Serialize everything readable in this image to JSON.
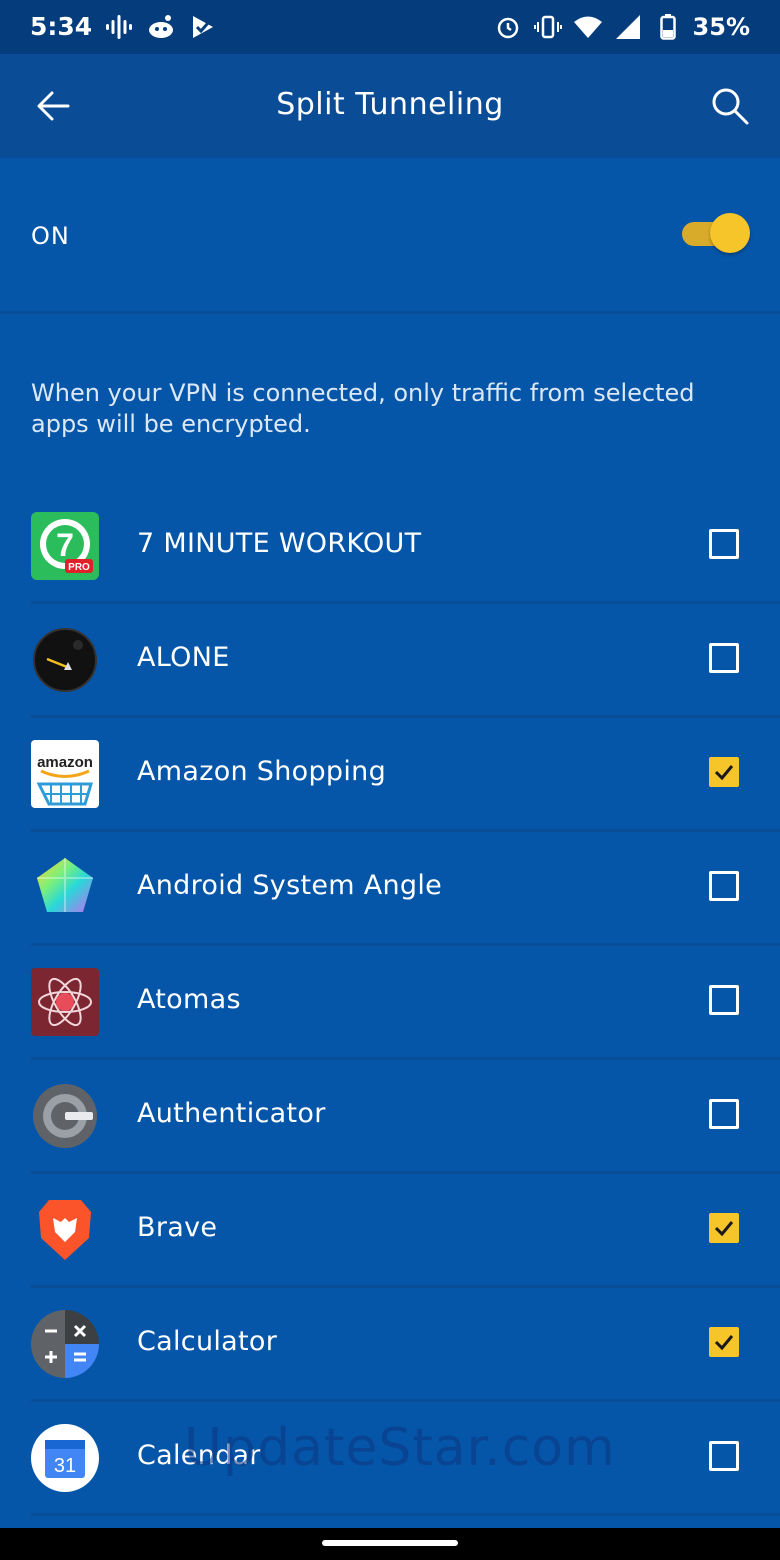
{
  "status_bar": {
    "time": "5:34",
    "battery": "35%",
    "left_icons": [
      "podcast-icon",
      "reddit-icon",
      "check-play-icon"
    ],
    "right_icons": [
      "alarm-icon",
      "vibrate-icon",
      "wifi-icon",
      "signal-icon",
      "battery-icon"
    ]
  },
  "app_bar": {
    "title": "Split Tunneling",
    "back_icon": "arrow-left-icon",
    "search_icon": "search-icon"
  },
  "toggle": {
    "label": "ON",
    "state": "on",
    "accent_color": "#f6c52a"
  },
  "description": "When your VPN is connected, only traffic from selected apps will be encrypted.",
  "apps": [
    {
      "name": "7 MINUTE WORKOUT",
      "icon": "seven-minute-workout-icon",
      "checked": false
    },
    {
      "name": "ALONE",
      "icon": "alone-icon",
      "checked": false
    },
    {
      "name": "Amazon Shopping",
      "icon": "amazon-icon",
      "checked": true
    },
    {
      "name": "Android System Angle",
      "icon": "angle-gem-icon",
      "checked": false
    },
    {
      "name": "Atomas",
      "icon": "atomas-icon",
      "checked": false
    },
    {
      "name": "Authenticator",
      "icon": "authenticator-icon",
      "checked": false
    },
    {
      "name": "Brave",
      "icon": "brave-lion-icon",
      "checked": true
    },
    {
      "name": "Calculator",
      "icon": "calculator-icon",
      "checked": true
    },
    {
      "name": "Calendar",
      "icon": "calendar-icon",
      "checked": false
    }
  ],
  "icon_text": {
    "seven": "7",
    "pro": "PRO",
    "amazon": "amazon",
    "calendar_day": "31"
  },
  "watermark": "UpdateStar.com",
  "colors": {
    "background": "#0556a8",
    "app_bar": "#0a4c95",
    "status_bar": "#043c7c",
    "checkbox_checked": "#f6c52a"
  }
}
